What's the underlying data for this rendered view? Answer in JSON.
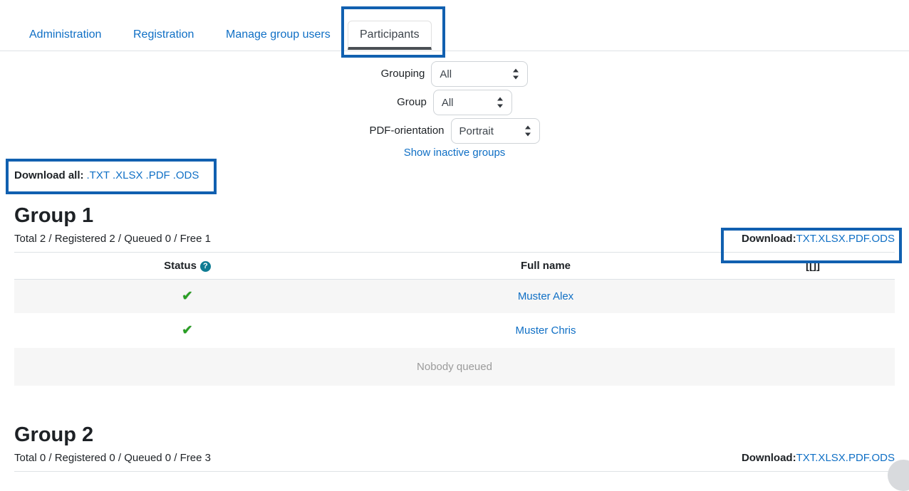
{
  "nav": {
    "tabs": [
      {
        "id": "administration",
        "label": "Administration",
        "active": false
      },
      {
        "id": "registration",
        "label": "Registration",
        "active": false
      },
      {
        "id": "manage-group-users",
        "label": "Manage group users",
        "active": false
      },
      {
        "id": "participants",
        "label": "Participants",
        "active": true
      }
    ]
  },
  "filters": {
    "grouping": {
      "label": "Grouping",
      "value": "All"
    },
    "group": {
      "label": "Group",
      "value": "All"
    },
    "pdf_orientation": {
      "label": "PDF-orientation",
      "value": "Portrait"
    },
    "show_inactive_groups_link": "Show inactive groups"
  },
  "download_all": {
    "label": "Download all:",
    "formats": [
      ".TXT",
      ".XLSX",
      ".PDF",
      ".ODS"
    ]
  },
  "table_headers": {
    "status": "Status",
    "status_help_icon": "?",
    "full_name": "Full name",
    "extra": "[[]]"
  },
  "empty_queue_text": "Nobody queued",
  "groups": [
    {
      "title": "Group 1",
      "stats": "Total 2 / Registered 2 / Queued 0 / Free 1",
      "download": {
        "label": "Download:",
        "formats": [
          "TXT",
          ".XLSX",
          ".PDF",
          ".ODS"
        ]
      },
      "rows": [
        {
          "status": "check",
          "name": "Muster Alex"
        },
        {
          "status": "check",
          "name": "Muster Chris"
        }
      ]
    },
    {
      "title": "Group 2",
      "stats": "Total 0 / Registered 0 / Queued 0 / Free 3",
      "download": {
        "label": "Download:",
        "formats": [
          "TXT",
          ".XLSX",
          ".PDF",
          ".ODS"
        ]
      },
      "rows": []
    }
  ],
  "colors": {
    "link": "#0f6fc5",
    "annotation": "#1160b0",
    "check": "#27a022",
    "help_icon": "#0f7c93",
    "row_stripe": "#f6f6f6",
    "muted_text": "#9b9b9b"
  },
  "icons": {
    "check": "✔",
    "scroll_top": "scroll-to-top-button"
  }
}
